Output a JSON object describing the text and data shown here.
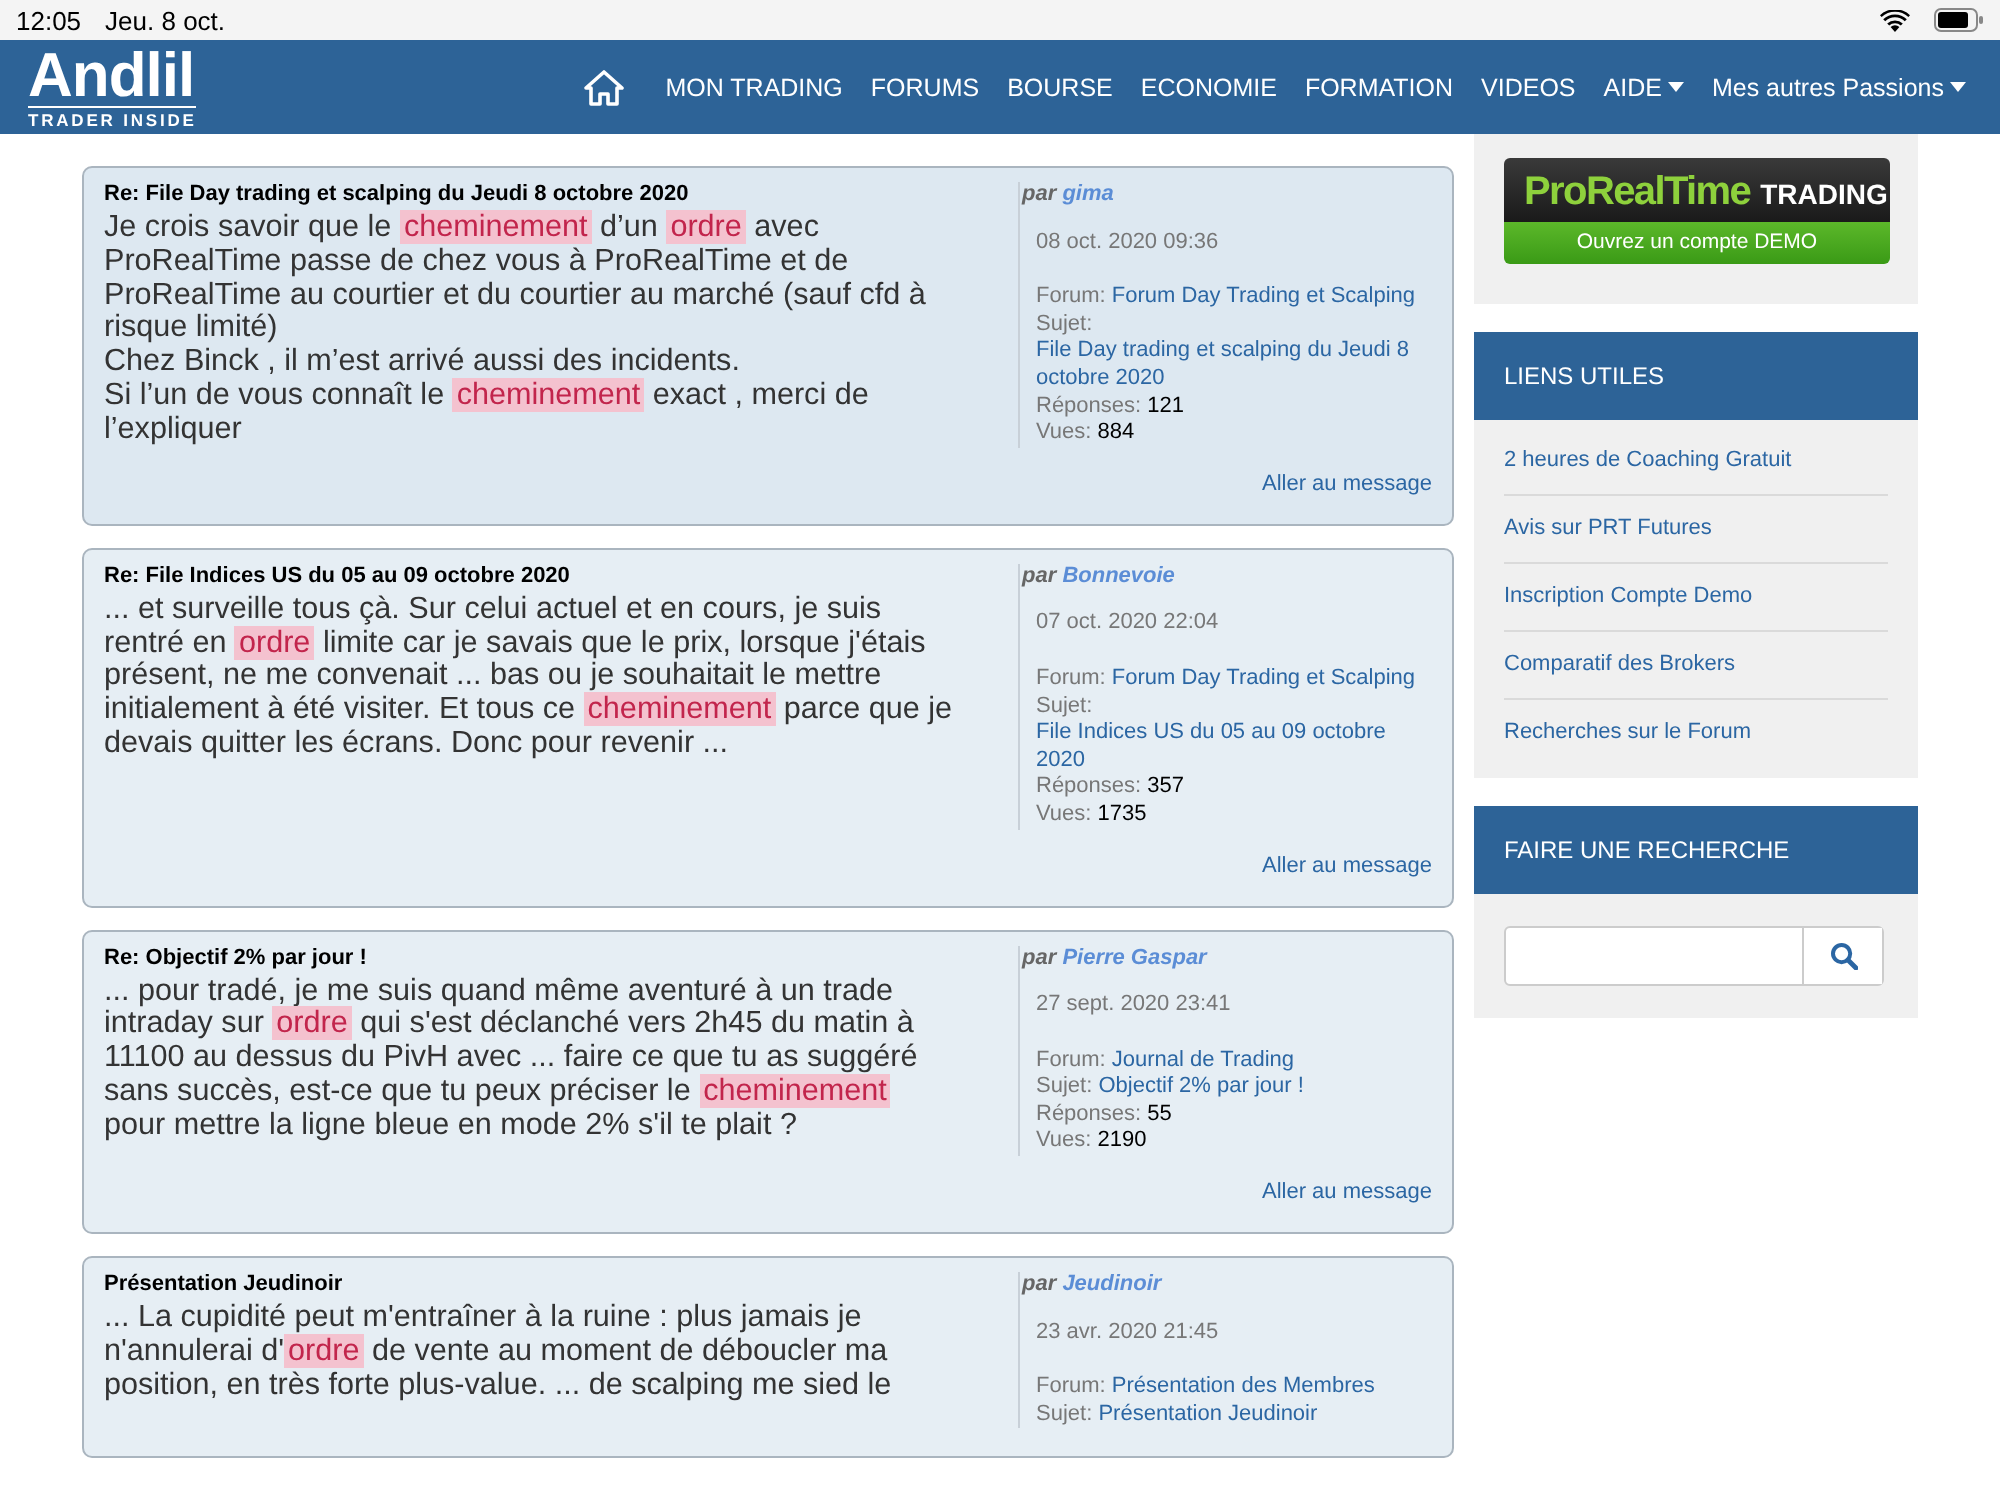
{
  "status_bar": {
    "time": "12:05",
    "date": "Jeu. 8 oct."
  },
  "header": {
    "logo": "Andlil",
    "tagline": "TRADER INSIDE",
    "nav": [
      {
        "label": "MON TRADING",
        "dropdown": false
      },
      {
        "label": "FORUMS",
        "dropdown": false
      },
      {
        "label": "BOURSE",
        "dropdown": false
      },
      {
        "label": "ECONOMIE",
        "dropdown": false
      },
      {
        "label": "FORMATION",
        "dropdown": false
      },
      {
        "label": "VIDEOS",
        "dropdown": false
      },
      {
        "label": "AIDE",
        "dropdown": true
      },
      {
        "label": "Mes autres Passions",
        "dropdown": true
      }
    ]
  },
  "results": [
    {
      "title": "Re: File Day trading et scalping du Jeudi 8 octobre 2020",
      "body": [
        {
          "text": "Je crois savoir que le ",
          "highlight": false
        },
        {
          "text": "cheminement",
          "highlight": true
        },
        {
          "text": " d’un ",
          "highlight": false
        },
        {
          "text": "ordre",
          "highlight": true
        },
        {
          "text": " avec ProRealTime passe de chez vous à ProRealTime et de ProRealTime au courtier et du courtier au marché (sauf cfd à risque limité)\nChez Binck , il m’est arrivé aussi des incidents.\nSi l’un de vous connaît le ",
          "highlight": false
        },
        {
          "text": "cheminement",
          "highlight": true
        },
        {
          "text": " exact , merci de l’expliquer",
          "highlight": false
        }
      ],
      "by": "par",
      "author": "gima",
      "date": "08 oct. 2020 09:36",
      "forum_label": "Forum:",
      "forum": "Forum Day Trading et Scalping",
      "subject_label": "Sujet:",
      "subject": "File Day trading et scalping du Jeudi 8 octobre 2020",
      "replies_label": "Réponses:",
      "replies": "121",
      "views_label": "Vues:",
      "views": "884",
      "link": "Aller au message"
    },
    {
      "title": "Re: File Indices US du 05 au 09 octobre 2020",
      "body": [
        {
          "text": "... et surveille tous çà. Sur celui actuel et en cours, je suis rentré en ",
          "highlight": false
        },
        {
          "text": "ordre",
          "highlight": true
        },
        {
          "text": " limite car je savais que le prix, lorsque j'étais présent, ne me convenait ... bas ou je souhaitait le mettre initialement à été visiter. Et tous ce ",
          "highlight": false
        },
        {
          "text": "cheminement",
          "highlight": true
        },
        {
          "text": " parce que je devais quitter les écrans. Donc pour revenir ...",
          "highlight": false
        }
      ],
      "by": "par",
      "author": "Bonnevoie",
      "date": "07 oct. 2020 22:04",
      "forum_label": "Forum:",
      "forum": "Forum Day Trading et Scalping",
      "subject_label": "Sujet:",
      "subject": "File Indices US du 05 au 09 octobre 2020",
      "replies_label": "Réponses:",
      "replies": "357",
      "views_label": "Vues:",
      "views": "1735",
      "link": "Aller au message"
    },
    {
      "title": "Re: Objectif 2% par jour !",
      "body": [
        {
          "text": "... pour tradé, je me suis quand même aventuré à un trade intraday sur ",
          "highlight": false
        },
        {
          "text": "ordre",
          "highlight": true
        },
        {
          "text": " qui s'est déclanché vers 2h45 du matin à 11100 au dessus du PivH avec ... faire ce que tu as suggéré sans succès, est-ce que tu peux préciser le ",
          "highlight": false
        },
        {
          "text": "cheminement",
          "highlight": true
        },
        {
          "text": " pour mettre la ligne bleue en mode 2% s'il te plait ?",
          "highlight": false
        }
      ],
      "by": "par",
      "author": "Pierre Gaspar",
      "date": "27 sept. 2020 23:41",
      "forum_label": "Forum:",
      "forum": "Journal de Trading",
      "subject_label": "Sujet:",
      "subject": "Objectif 2% par jour !",
      "replies_label": "Réponses:",
      "replies": "55",
      "views_label": "Vues:",
      "views": "2190",
      "link": "Aller au message"
    },
    {
      "title": "Présentation Jeudinoir",
      "body": [
        {
          "text": "... La cupidité peut m'entraîner à la ruine : plus jamais je n'annulerai d'",
          "highlight": false
        },
        {
          "text": "ordre",
          "highlight": true
        },
        {
          "text": " de vente au moment de déboucler ma position, en très forte plus-value. ... de scalping me sied le",
          "highlight": false
        }
      ],
      "by": "par",
      "author": "Jeudinoir",
      "date": "23 avr. 2020 21:45",
      "forum_label": "Forum:",
      "forum": "Présentation des Membres",
      "subject_label": "Sujet:",
      "subject": "Présentation Jeudinoir"
    }
  ],
  "sidebar": {
    "ad": {
      "brand": "ProRealTime",
      "brand_suffix": "TRADING",
      "cta": "Ouvrez un compte DEMO"
    },
    "links_title": "LIENS UTILES",
    "links": [
      "2 heures de Coaching Gratuit",
      "Avis sur PRT Futures",
      "Inscription Compte Demo",
      "Comparatif des Brokers",
      "Recherches sur le Forum"
    ],
    "search_title": "FAIRE UNE RECHERCHE"
  }
}
